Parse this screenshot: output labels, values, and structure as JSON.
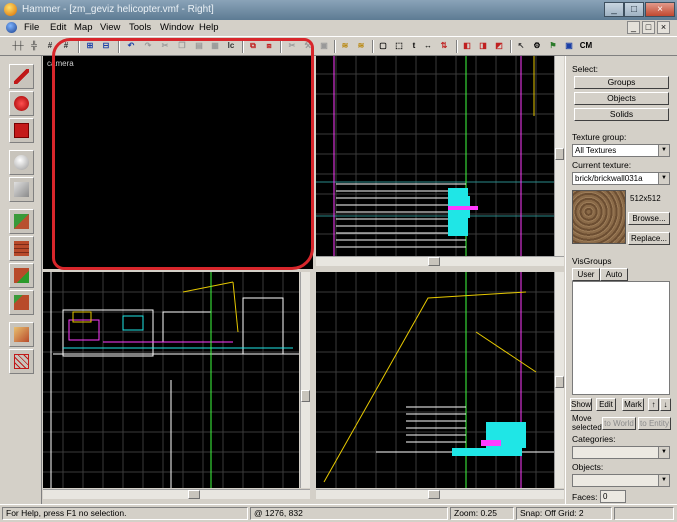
{
  "window": {
    "title": "Hammer - [zm_geviz helicopter.vmf - Right]",
    "controls": [
      "_",
      "□",
      "×"
    ]
  },
  "menu": {
    "items": [
      "File",
      "Edit",
      "Map",
      "View",
      "Tools",
      "Window",
      "Help"
    ],
    "mdi_controls": [
      "_",
      "□",
      "×"
    ]
  },
  "toolbar": {
    "buttons": [
      "grid-toggle",
      "grid-larger",
      "grid-smaller",
      "3d-grid",
      "group-ignore",
      "undo",
      "redo",
      "cut",
      "copy",
      "paste",
      "texture-lock",
      "carve",
      "hollow",
      "clip",
      "vertex",
      "text",
      "align",
      "quick-hide",
      "hide",
      "unhide",
      "cordon",
      "compile",
      "CM"
    ],
    "cm_label": "CM",
    "t_label": "t",
    "lc_label": "lc"
  },
  "tools": [
    "selection-tool",
    "magnify-tool",
    "camera-tool",
    "entity-tool",
    "block-tool",
    "toggle-texture-tool",
    "apply-texture-tool",
    "decal-tool",
    "overlay-tool",
    "clipping-tool",
    "vertex-tool"
  ],
  "viewports": {
    "camera_label": "camera",
    "top_right_label": "",
    "bottom_left_label": "",
    "bottom_right_label": ""
  },
  "select_panel": {
    "heading": "Select:",
    "buttons": [
      "Groups",
      "Objects",
      "Solids"
    ]
  },
  "texture_panel": {
    "group_label": "Texture group:",
    "group_value": "All Textures",
    "current_label": "Current texture:",
    "current_value": "brick/brickwall031a",
    "size_text": "512x512",
    "browse_label": "Browse...",
    "replace_label": "Replace..."
  },
  "visgroups": {
    "heading": "VisGroups",
    "tabs": [
      "User",
      "Auto"
    ],
    "show_label": "Show",
    "edit_label": "Edit",
    "mark_label": "Mark",
    "up": "↑",
    "down": "↓"
  },
  "move_selected": {
    "label": "Move selected:",
    "to_world": "to World",
    "to_entity": "to Entity"
  },
  "categories_label": "Categories:",
  "objects_label": "Objects:",
  "faces_label": "Faces:",
  "faces_value": "0",
  "status": {
    "help": "For Help, press F1",
    "selection": "no selection.",
    "coords": "@ 1276, 832",
    "zoom": "Zoom: 0.25",
    "snap": "Snap: Off Grid: 2"
  },
  "colors": {
    "viewport_bg": "#000000",
    "grid": "#3a3a3a",
    "grid_major": "#707070",
    "accent_cyan": "#1fe6e6",
    "accent_magenta": "#ff3cff",
    "accent_yellow": "#e6c800",
    "accent_green": "#40ff40",
    "annotation_red": "#d8262b"
  }
}
